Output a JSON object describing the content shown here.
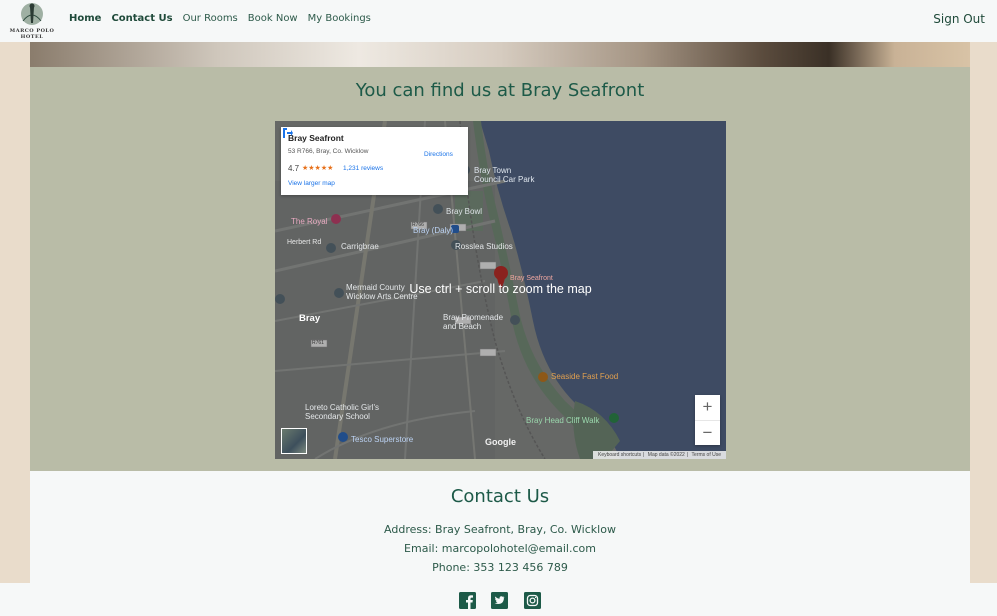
{
  "nav": {
    "logo_text": "MARCO POLO HOTEL",
    "links": [
      {
        "label": "Home"
      },
      {
        "label": "Contact Us"
      },
      {
        "label": "Our Rooms"
      },
      {
        "label": "Book Now"
      },
      {
        "label": "My Bookings"
      }
    ],
    "signout_label": "Sign Out"
  },
  "map_section": {
    "title": "You can find us at Bray Seafront",
    "map": {
      "overlay_message": "Use ctrl + scroll to zoom the map",
      "card": {
        "name": "Bray Seafront",
        "address": "53 R766, Bray, Co. Wicklow",
        "rating": "4.7",
        "stars": "★★★★★",
        "reviews": "1,231 reviews",
        "larger_map": "View larger map",
        "directions": "Directions"
      },
      "labels": {
        "car_park": "Bray Town\nCouncil Car Park",
        "the_royal": "The Royal",
        "bray_bowl": "Bray Bowl",
        "herbert_rd": "Herbert Rd",
        "carrigbrae": "Carrigbrae",
        "bray_daly": "Bray (Daly)",
        "rosslea": "Rosslea Studios",
        "bray_seafront": "Bray Seafront",
        "mermaid": "Mermaid County\nWicklow Arts Centre",
        "bray": "Bray",
        "promenade": "Bray Promenade\nand Beach",
        "seaside": "Seaside Fast Food",
        "loreto": "Loreto Catholic Girl's\nSecondary School",
        "cliff_walk": "Bray Head Cliff Walk",
        "tesco": "Tesco Superstore",
        "r766": "R766",
        "r761": "R761"
      },
      "zoom_in": "+",
      "zoom_out": "−",
      "google": "Google",
      "attribution": [
        "Keyboard shortcuts",
        "Map data ©2022",
        "Terms of Use"
      ]
    }
  },
  "contact": {
    "title": "Contact Us",
    "address": "Address: Bray Seafront, Bray, Co. Wicklow",
    "email": "Email: marcopolohotel@email.com",
    "phone": "Phone: 353 123 456 789"
  },
  "footer": {
    "social": [
      {
        "icon": "facebook-icon"
      },
      {
        "icon": "twitter-icon"
      },
      {
        "icon": "instagram-icon"
      }
    ]
  },
  "colors": {
    "brand_green": "#1d5a48",
    "map_section_bg": "#b9bca7",
    "page_bg": "#e9dccb"
  }
}
